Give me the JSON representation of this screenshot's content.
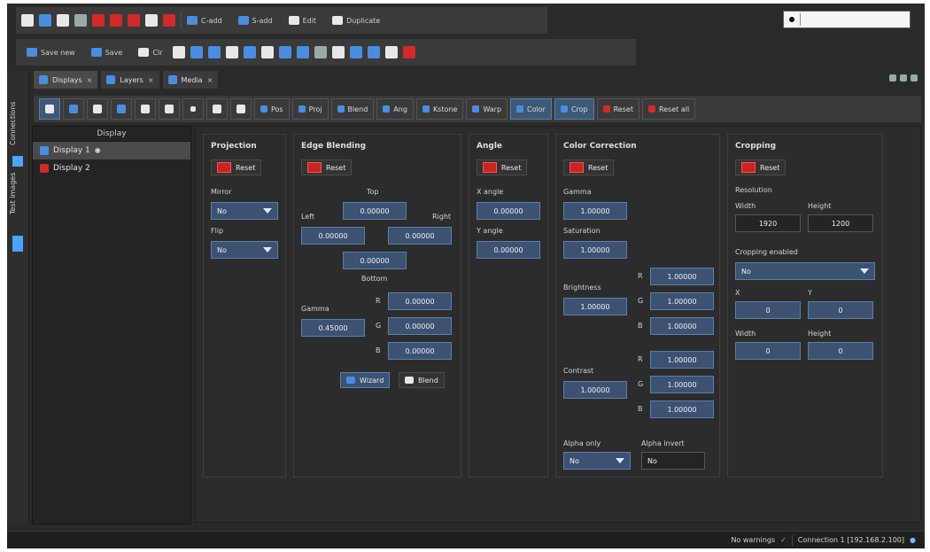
{
  "toolbar_top": {
    "row1": {
      "c_add": "C-add",
      "s_add": "S-add",
      "edit": "Edit",
      "duplicate": "Duplicate"
    },
    "row2": {
      "save_new": "Save new",
      "save": "Save",
      "clr": "Clr"
    }
  },
  "tabs": [
    {
      "label": "Displays",
      "close": "×"
    },
    {
      "label": "Layers",
      "close": "×"
    },
    {
      "label": "Media",
      "close": "×"
    }
  ],
  "strip": {
    "connections": "Connections",
    "test_images": "Test images"
  },
  "toolbar": {
    "pos": "Pos",
    "proj": "Proj",
    "blend": "Blend",
    "ang": "Ang",
    "kstone": "Kstone",
    "warp": "Warp",
    "color": "Color",
    "crop": "Crop",
    "reset": "Reset",
    "reset_all": "Reset all"
  },
  "display_list": {
    "header": "Display",
    "items": [
      "Display 1",
      "Display 2"
    ]
  },
  "projection": {
    "title": "Projection",
    "reset": "Reset",
    "mirror_label": "Mirror",
    "mirror_value": "No",
    "flip_label": "Flip",
    "flip_value": "No"
  },
  "edge_blending": {
    "title": "Edge Blending",
    "reset": "Reset",
    "top_label": "Top",
    "left_label": "Left",
    "right_label": "Right",
    "bottom_label": "Bottom",
    "top": "0.00000",
    "left": "0.00000",
    "right": "0.00000",
    "bottom": "0.00000",
    "gamma_label": "Gamma",
    "gamma": "0.45000",
    "r_label": "R",
    "g_label": "G",
    "b_label": "B",
    "gamma_r": "0.00000",
    "gamma_g": "0.00000",
    "gamma_b": "0.00000",
    "wizard": "Wizard",
    "blend": "Blend"
  },
  "angle": {
    "title": "Angle",
    "reset": "Reset",
    "x_label": "X angle",
    "x": "0.00000",
    "y_label": "Y angle",
    "y": "0.00000"
  },
  "color_correction": {
    "title": "Color Correction",
    "reset": "Reset",
    "gamma_label": "Gamma",
    "gamma": "1.00000",
    "saturation_label": "Saturation",
    "saturation": "1.00000",
    "brightness_label": "Brightness",
    "brightness": "1.00000",
    "r_label": "R",
    "g_label": "G",
    "b_label": "B",
    "brightness_r": "1.00000",
    "brightness_g": "1.00000",
    "brightness_b": "1.00000",
    "contrast_label": "Contrast",
    "contrast": "1.00000",
    "contrast_r": "1.00000",
    "contrast_g": "1.00000",
    "contrast_b": "1.00000",
    "alpha_only_label": "Alpha only",
    "alpha_only": "No",
    "alpha_invert_label": "Alpha invert",
    "alpha_invert": "No"
  },
  "cropping": {
    "title": "Cropping",
    "reset": "Reset",
    "resolution_label": "Resolution",
    "width_label": "Width",
    "height_label": "Height",
    "width": "1920",
    "height": "1200",
    "enabled_label": "Cropping enabled",
    "enabled": "No",
    "x_label": "X",
    "y_label": "Y",
    "x": "0",
    "y": "0",
    "crop_width_label": "Width",
    "crop_height_label": "Height",
    "crop_width": "0",
    "crop_height": "0"
  },
  "status": {
    "warnings": "No warnings",
    "connection": "Connection 1 [192.168.2.100]"
  }
}
